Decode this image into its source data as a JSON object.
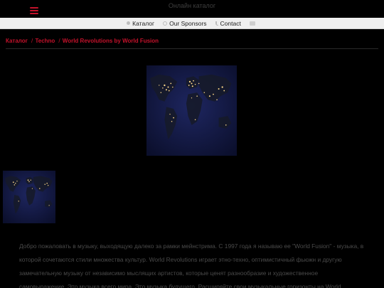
{
  "header": {
    "site_title": "Онлайн каталог",
    "menu_icon": "hamburger-menu-icon",
    "accent_color": "#c4122b"
  },
  "nav": {
    "items": [
      {
        "label": "Каталог",
        "icon": "dot-icon"
      },
      {
        "label": "Our Sponsors",
        "icon": "circle-icon"
      },
      {
        "label": "Contact",
        "icon": "phone-icon"
      },
      {
        "label": "",
        "icon": "mail-icon"
      }
    ]
  },
  "breadcrumb": {
    "items": [
      "Каталог",
      "Techno",
      "World Revolutions by World Fusion"
    ],
    "separator": "/"
  },
  "product": {
    "main_image": "world-night-lights-map",
    "thumbnail": "world-night-lights-map-thumbnail",
    "description": "Добро пожаловать в музыку, выходящую далеко за рамки мейнстрима. С 1997 года я называю ее \"World Fusion\" - музыка, в которой сочетаются стили множества культур. World Revolutions играет этно-техно, оптимистичный фьюжн и другую замечательную музыку от независимо мыслящих артистов, которые ценят разнообразие и художественное самовыражение. Это музыка всего мира. Это музыка будущего. Расширяйте свои музыкальные горизонты на World"
  }
}
